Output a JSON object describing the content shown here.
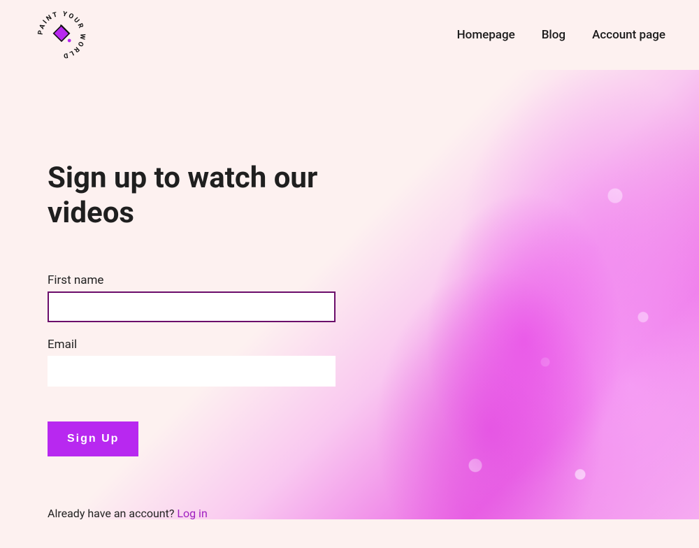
{
  "brand": {
    "name": "PAINT YOUR WORLD",
    "icon": "paint-bucket-icon"
  },
  "nav": {
    "items": [
      {
        "label": "Homepage"
      },
      {
        "label": "Blog"
      },
      {
        "label": "Account page"
      }
    ]
  },
  "signup": {
    "title": "Sign up to watch our videos",
    "fields": {
      "first_name": {
        "label": "First name",
        "value": ""
      },
      "email": {
        "label": "Email",
        "value": ""
      }
    },
    "submit_label": "Sign Up",
    "login_prompt": "Already have an account? ",
    "login_link": "Log in"
  },
  "colors": {
    "accent": "#b828f0",
    "focus_border": "#6b0d6b",
    "link": "#a020c0",
    "bg": "#fdf1f0"
  }
}
